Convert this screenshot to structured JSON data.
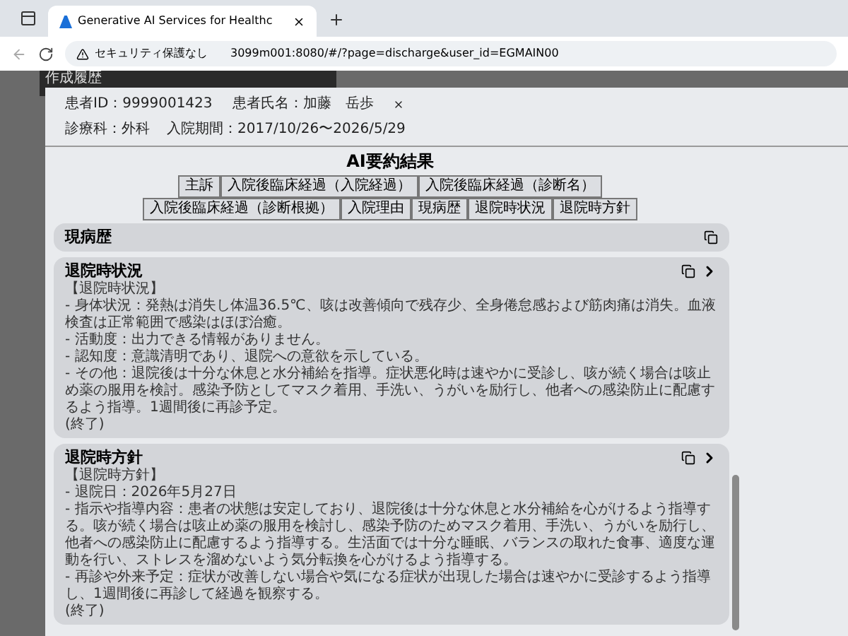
{
  "browser": {
    "tab_title": "Generative AI Services for Healthc",
    "security_label": "セキュリティ保護なし",
    "url": "3099m001:8080/#/?page=discharge&user_id=EGMAIN00"
  },
  "history_panel": {
    "title": "作成履歴"
  },
  "modal": {
    "patient_id": "患者ID：9999001423",
    "patient_name": "患者氏名：加藤　岳歩",
    "department": "診療科：外科",
    "period": "入院期間：2017/10/26〜2026/5/29",
    "title": "AI要約結果",
    "tab_rows": [
      [
        "主訴",
        "入院後臨床経過（入院経過）",
        "入院後臨床経過（診断名）"
      ],
      [
        "入院後臨床経過（診断根拠）",
        "入院理由",
        "現病歴",
        "退院時状況",
        "退院時方針"
      ]
    ],
    "sections": [
      {
        "title": "現病歴",
        "expanded": false
      },
      {
        "title": "退院時状況",
        "expanded": true,
        "lines": [
          "【退院時状況】",
          "- 身体状況：発熱は消失し体温36.5℃、咳は改善傾向で残存少、全身倦怠感および筋肉痛は消失。血液検査は正常範囲で感染はほぼ治癒。",
          "- 活動度：出力できる情報がありません。",
          "- 認知度：意識清明であり、退院への意欲を示している。",
          "- その他：退院後は十分な休息と水分補給を指導。症状悪化時は速やかに受診し、咳が続く場合は咳止め薬の服用を検討。感染予防としてマスク着用、手洗い、うがいを励行し、他者への感染防止に配慮するよう指導。1週間後に再診予定。",
          "(終了)"
        ]
      },
      {
        "title": "退院時方針",
        "expanded": true,
        "lines": [
          "【退院時方針】",
          "- 退院日：2026年5月27日",
          "- 指示や指導内容：患者の状態は安定しており、退院後は十分な休息と水分補給を心がけるよう指導する。咳が続く場合は咳止め薬の服用を検討し、感染予防のためマスク着用、手洗い、うがいを励行し、他者への感染防止に配慮するよう指導する。生活面では十分な睡眠、バランスの取れた食事、適度な運動を行い、ストレスを溜めないよう気分転換を心がけるよう指導する。",
          "- 再診や外来予定：症状が改善しない場合や気になる症状が出現した場合は速やかに受診するよう指導し、1週間後に再診して経過を観察する。",
          "(終了)"
        ]
      }
    ]
  }
}
